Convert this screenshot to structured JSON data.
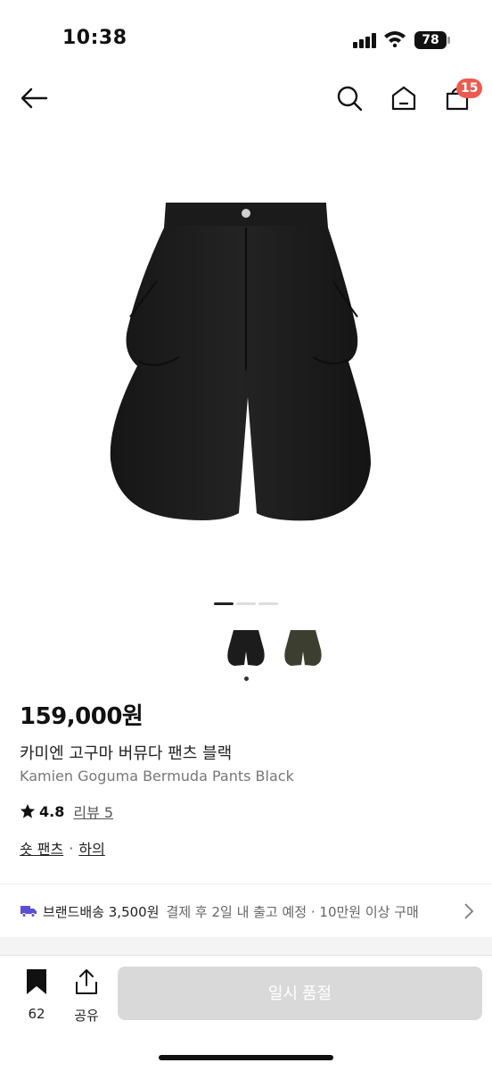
{
  "status_bar": {
    "time": "10:38",
    "battery": "78"
  },
  "header": {
    "back_icon": "arrow-left-icon",
    "search_icon": "search-icon",
    "home_icon": "home-icon",
    "cart_icon": "shopping-bag-icon",
    "cart_count": "15"
  },
  "gallery": {
    "page_count": 3,
    "active_page": 1,
    "colors": [
      {
        "name": "black-swatch",
        "color": "#1c1c1c"
      },
      {
        "name": "olive-swatch",
        "color": "#3c3f30"
      }
    ]
  },
  "product": {
    "price": "159,000원",
    "name_ko": "카미엔 고구마 버뮤다 팬츠 블랙",
    "name_en": "Kamien Goguma Bermuda Pants Black",
    "rating": "4.8",
    "review_label": "리뷰 5",
    "category_main": "숏 팬츠",
    "category_separator": "·",
    "category_parent": "하의"
  },
  "shipping": {
    "label": "브랜드배송 3,500원",
    "detail": "결제 후 2일 내 출고 예정 · 10만원 이상 구매"
  },
  "bottom_bar": {
    "like_count": "62",
    "share_label": "공유",
    "buy_label": "일시 품절"
  },
  "colors": {
    "accent_badge": "#ee5a4f",
    "shipping_icon": "#5b4fd6",
    "disabled_button": "#d9d9d9"
  }
}
